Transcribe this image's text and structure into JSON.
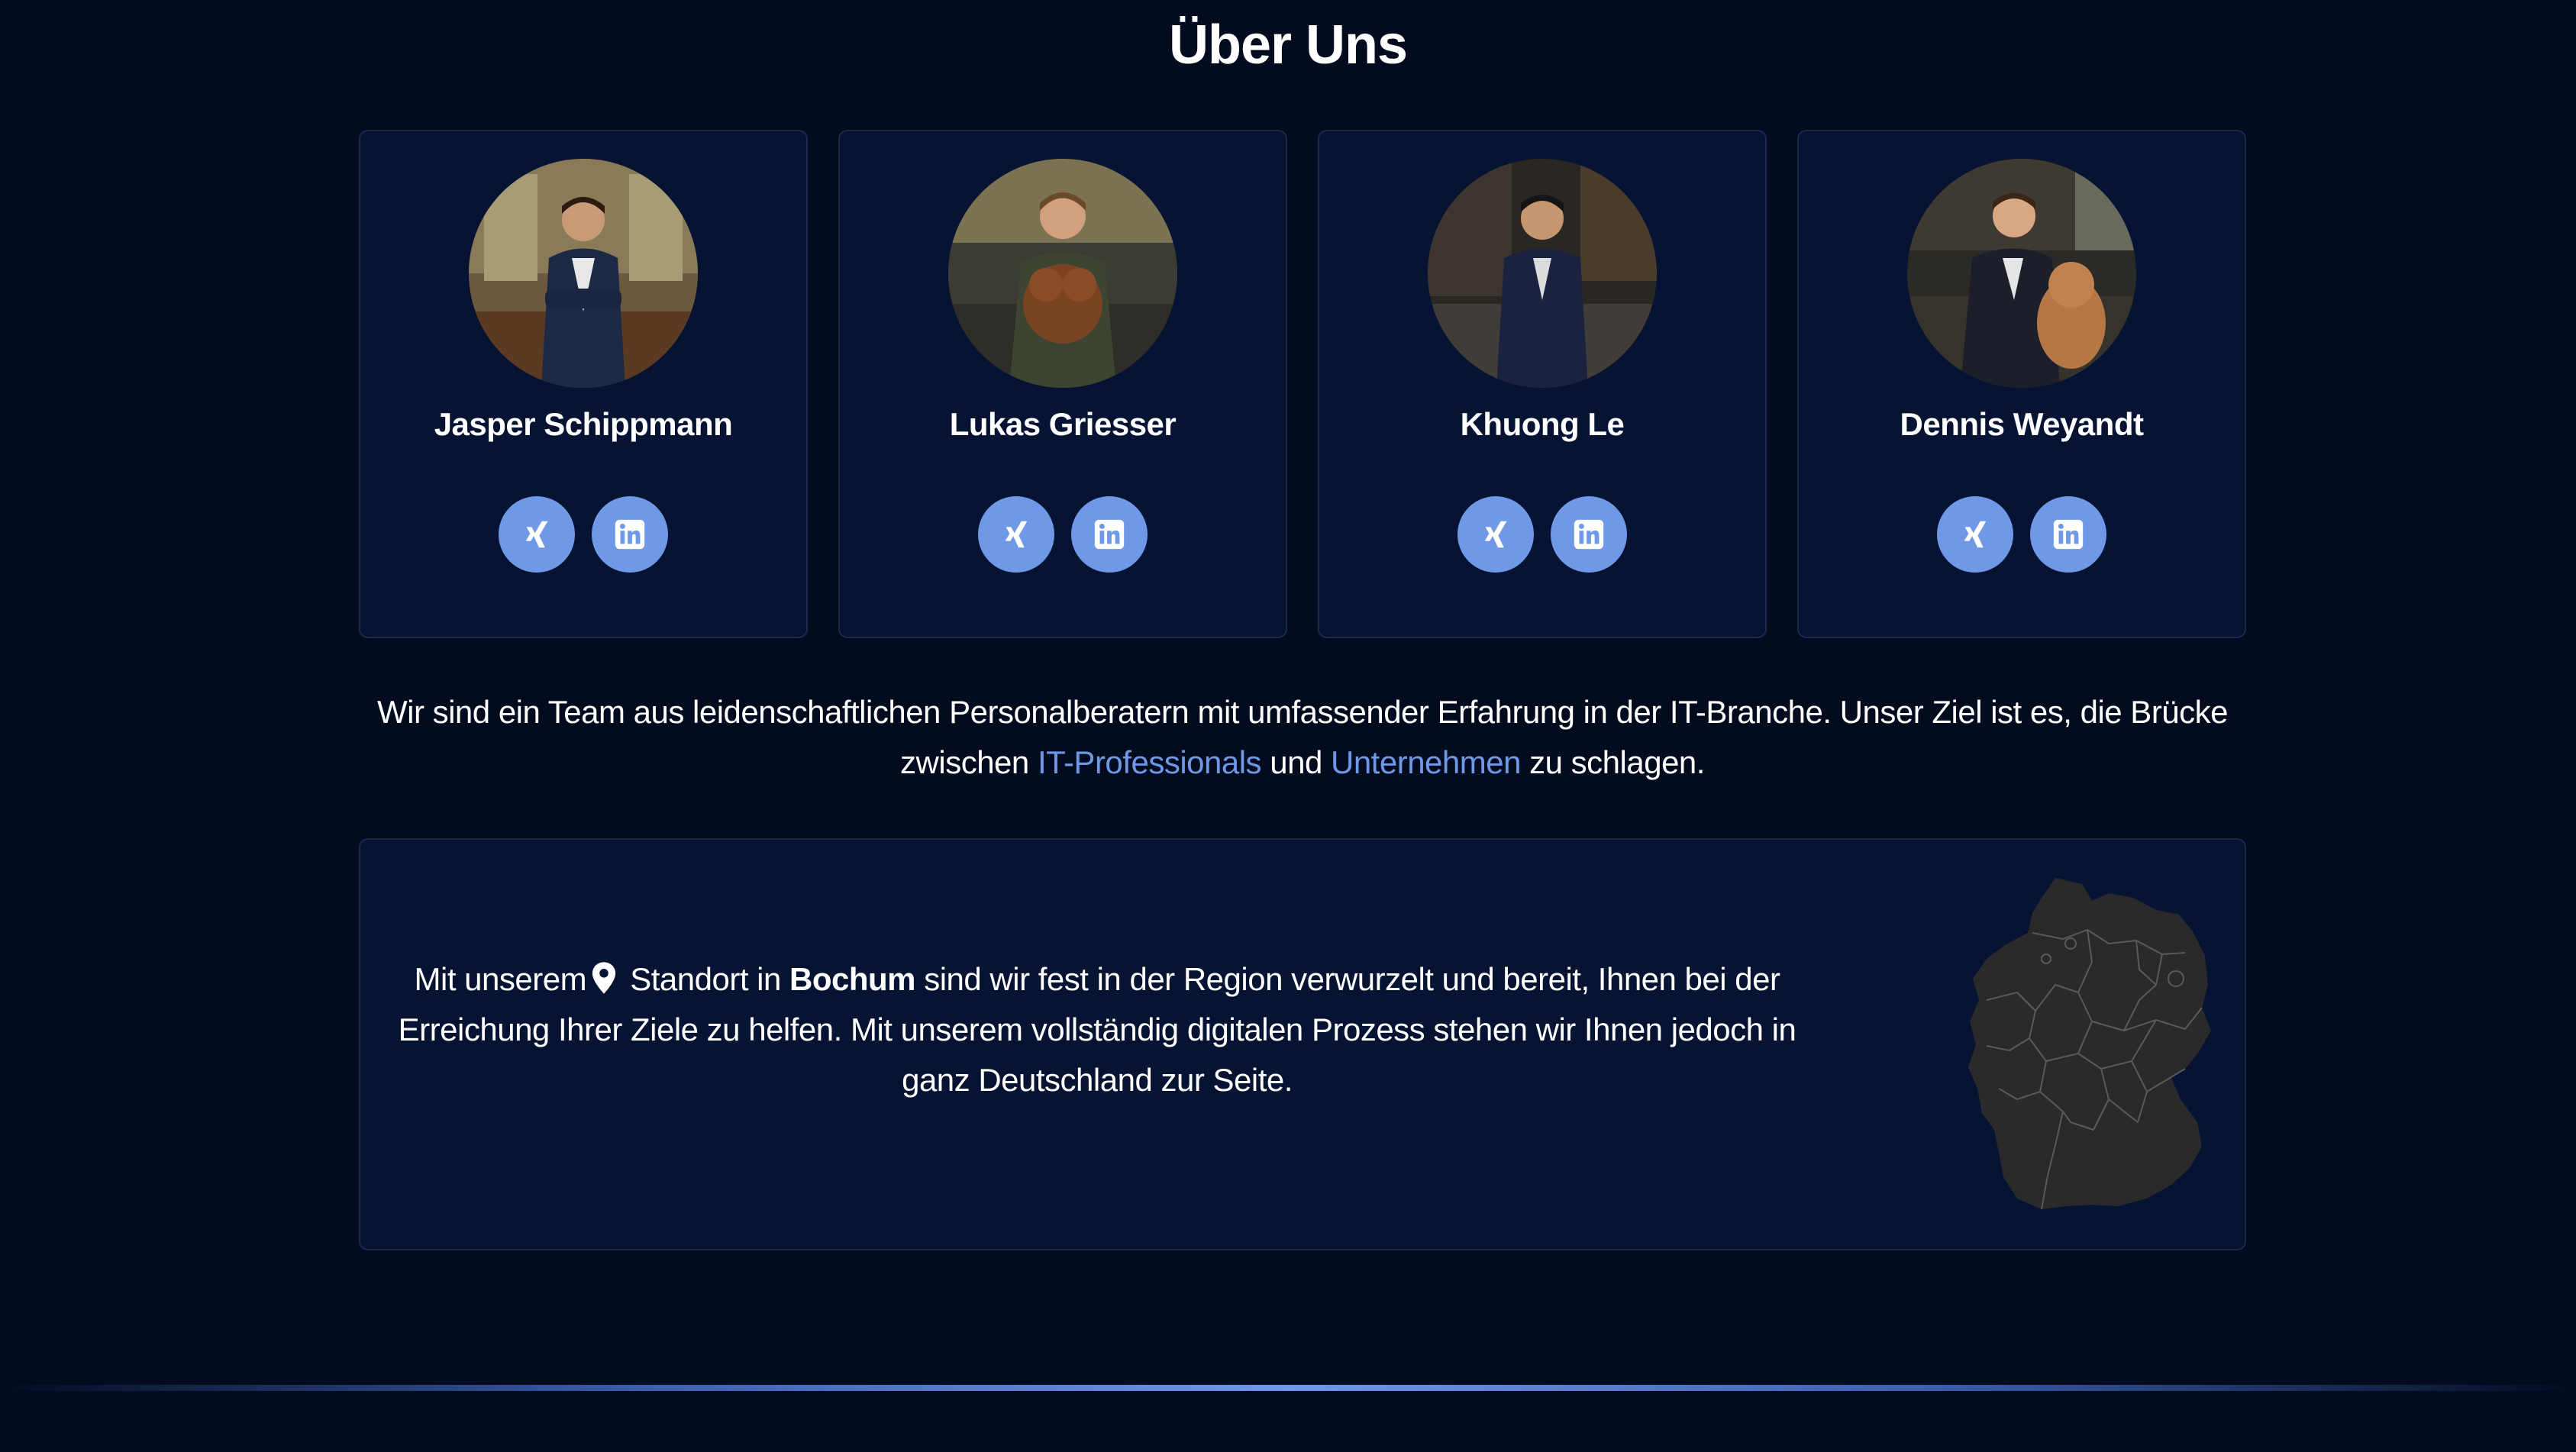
{
  "section": {
    "title": "Über Uns"
  },
  "team": [
    {
      "name": "Jasper Schippmann",
      "xing_icon": "xing-icon",
      "linkedin_icon": "linkedin-icon"
    },
    {
      "name": "Lukas Griesser",
      "xing_icon": "xing-icon",
      "linkedin_icon": "linkedin-icon"
    },
    {
      "name": "Khuong Le",
      "xing_icon": "xing-icon",
      "linkedin_icon": "linkedin-icon"
    },
    {
      "name": "Dennis Weyandt",
      "xing_icon": "xing-icon",
      "linkedin_icon": "linkedin-icon"
    }
  ],
  "intro": {
    "text_before": "Wir sind ein Team aus leidenschaftlichen Personalberatern mit umfassender Erfahrung in der IT-Branche. Unser Ziel ist es, die Brücke zwischen ",
    "link_professionals": "IT-Professionals",
    "text_middle": " und ",
    "link_companies": "Unternehmen",
    "text_after": " zu schlagen."
  },
  "location": {
    "text_before": "Mit unserem",
    "text_standort": " Standort in ",
    "city": "Bochum",
    "text_after": " sind wir fest in der Region verwurzelt und bereit, Ihnen bei der Erreichung Ihrer Ziele zu helfen. Mit unserem vollständig digitalen Prozess stehen wir Ihnen jedoch in ganz Deutschland zur Seite.",
    "pin_icon": "map-pin-icon",
    "map_icon": "germany-map"
  },
  "colors": {
    "background": "#030b1f",
    "card": "#071333",
    "accent": "#6f98e6",
    "map": "#2a2a2a"
  }
}
